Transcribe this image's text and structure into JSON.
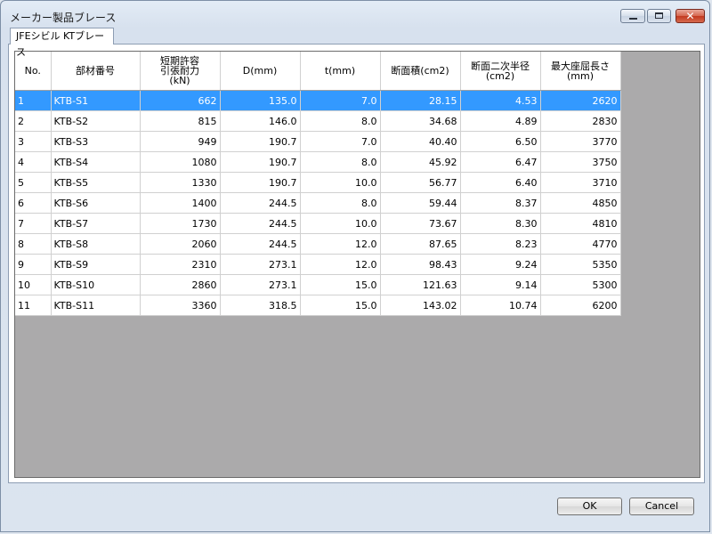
{
  "window": {
    "title": "メーカー製品ブレース",
    "close_glyph": "✕"
  },
  "tab": {
    "label": "JFEシビル KTブレース"
  },
  "table": {
    "headers": [
      "No.",
      "部材番号",
      "短期許容\n引張耐力\n(kN)",
      "D(mm)",
      "t(mm)",
      "断面積(cm2)",
      "断面二次半径\n(cm2)",
      "最大座屈長さ\n(mm)"
    ],
    "rows": [
      [
        "1",
        "KTB-S1",
        "662",
        "135.0",
        "7.0",
        "28.15",
        "4.53",
        "2620"
      ],
      [
        "2",
        "KTB-S2",
        "815",
        "146.0",
        "8.0",
        "34.68",
        "4.89",
        "2830"
      ],
      [
        "3",
        "KTB-S3",
        "949",
        "190.7",
        "7.0",
        "40.40",
        "6.50",
        "3770"
      ],
      [
        "4",
        "KTB-S4",
        "1080",
        "190.7",
        "8.0",
        "45.92",
        "6.47",
        "3750"
      ],
      [
        "5",
        "KTB-S5",
        "1330",
        "190.7",
        "10.0",
        "56.77",
        "6.40",
        "3710"
      ],
      [
        "6",
        "KTB-S6",
        "1400",
        "244.5",
        "8.0",
        "59.44",
        "8.37",
        "4850"
      ],
      [
        "7",
        "KTB-S7",
        "1730",
        "244.5",
        "10.0",
        "73.67",
        "8.30",
        "4810"
      ],
      [
        "8",
        "KTB-S8",
        "2060",
        "244.5",
        "12.0",
        "87.65",
        "8.23",
        "4770"
      ],
      [
        "9",
        "KTB-S9",
        "2310",
        "273.1",
        "12.0",
        "98.43",
        "9.24",
        "5350"
      ],
      [
        "10",
        "KTB-S10",
        "2860",
        "273.1",
        "15.0",
        "121.63",
        "9.14",
        "5300"
      ],
      [
        "11",
        "KTB-S11",
        "3360",
        "318.5",
        "15.0",
        "143.02",
        "10.74",
        "6200"
      ]
    ],
    "selected_row": 0
  },
  "buttons": {
    "ok": "OK",
    "cancel": "Cancel"
  },
  "colors": {
    "selection": "#3399ff",
    "grid_background": "#abaaab"
  }
}
